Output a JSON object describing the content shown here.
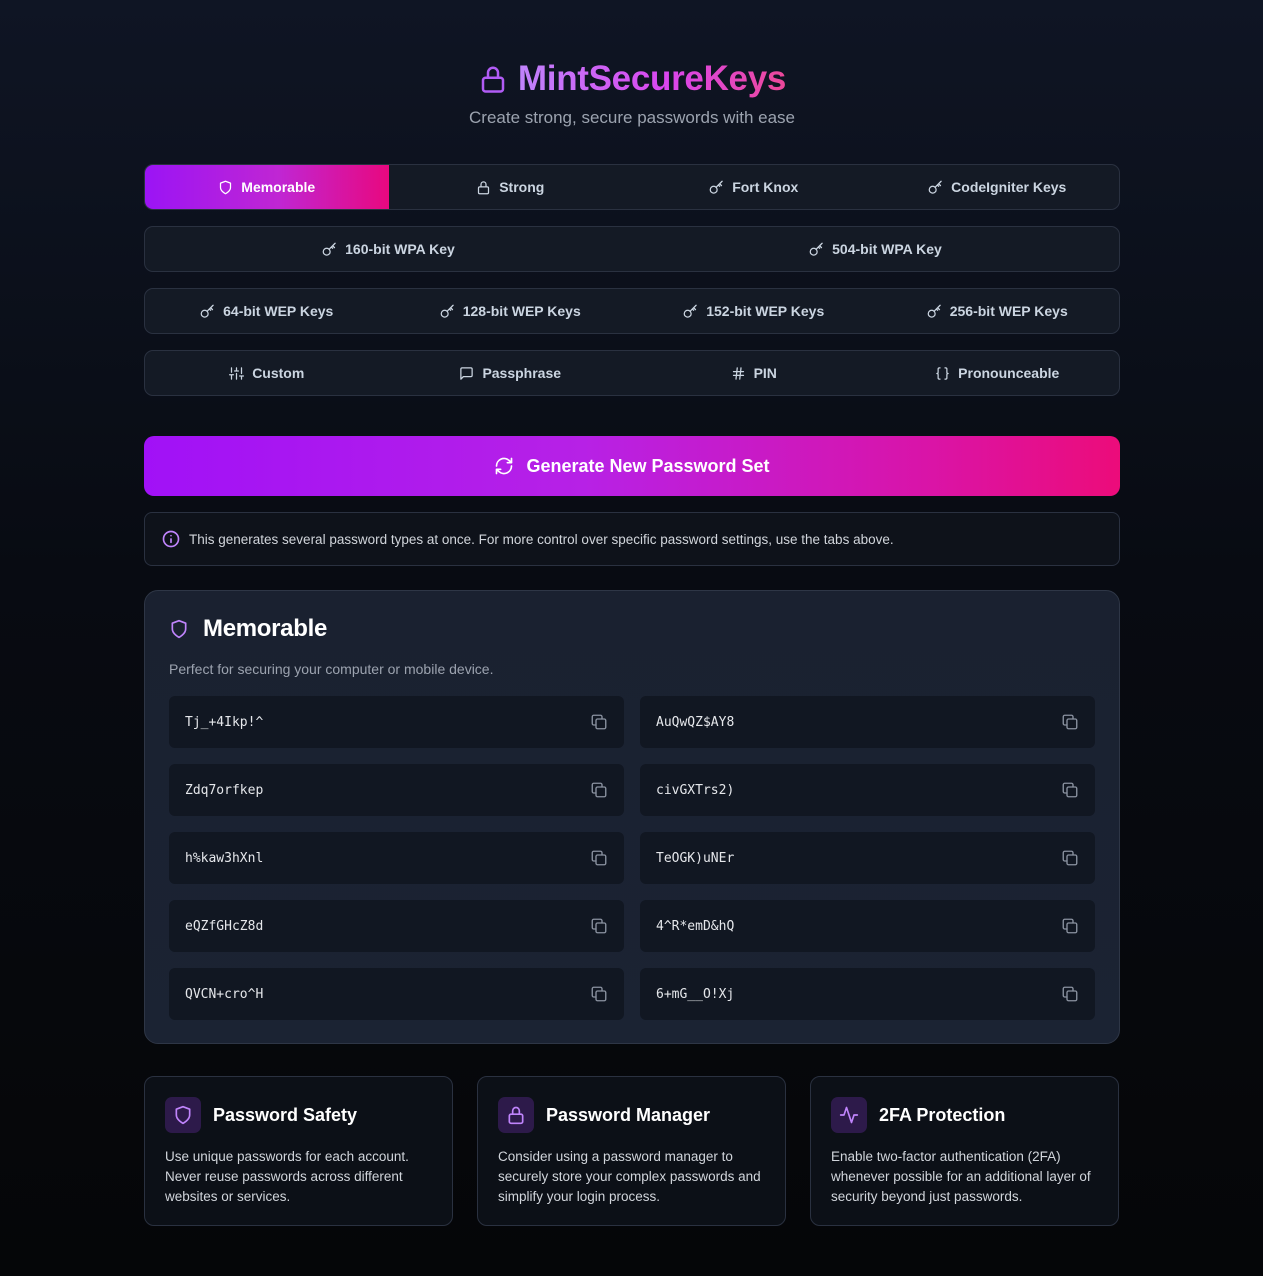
{
  "header": {
    "app_title": "MintSecureKeys",
    "subtitle": "Create strong, secure passwords with ease"
  },
  "tabs": {
    "row1": [
      {
        "label": "Memorable",
        "icon": "shield-icon",
        "active": true
      },
      {
        "label": "Strong",
        "icon": "lock-icon"
      },
      {
        "label": "Fort Knox",
        "icon": "key-icon"
      },
      {
        "label": "CodeIgniter Keys",
        "icon": "key-icon"
      }
    ],
    "row2": [
      {
        "label": "160-bit WPA Key",
        "icon": "key-icon"
      },
      {
        "label": "504-bit WPA Key",
        "icon": "key-icon"
      }
    ],
    "row3": [
      {
        "label": "64-bit WEP Keys",
        "icon": "key-icon"
      },
      {
        "label": "128-bit WEP Keys",
        "icon": "key-icon"
      },
      {
        "label": "152-bit WEP Keys",
        "icon": "key-icon"
      },
      {
        "label": "256-bit WEP Keys",
        "icon": "key-icon"
      }
    ],
    "row4": [
      {
        "label": "Custom",
        "icon": "sliders-icon"
      },
      {
        "label": "Passphrase",
        "icon": "message-icon"
      },
      {
        "label": "PIN",
        "icon": "hash-icon"
      },
      {
        "label": "Pronounceable",
        "icon": "braces-icon"
      }
    ]
  },
  "generate_button": {
    "label": "Generate New Password Set",
    "icon": "refresh-icon"
  },
  "info": {
    "text": "This generates several password types at once. For more control over specific password settings, use the tabs above.",
    "icon": "info-icon"
  },
  "result_card": {
    "title": "Memorable",
    "description": "Perfect for securing your computer or mobile device.",
    "passwords": [
      "Tj_+4Ikp!^",
      "AuQwQZ$AY8",
      "Zdq7orfkep",
      "civGXTrs2)",
      "h%kaw3hXnl",
      "TeOGK)uNEr",
      "eQZfGHcZ8d",
      "4^R*emD&hQ",
      "QVCN+cro^H",
      "6+mG__O!Xj"
    ]
  },
  "tips": [
    {
      "title": "Password Safety",
      "icon": "shield-icon",
      "text": "Use unique passwords for each account. Never reuse passwords across different websites or services."
    },
    {
      "title": "Password Manager",
      "icon": "lock-icon",
      "text": "Consider using a password manager to securely store your complex passwords and simplify your login process."
    },
    {
      "title": "2FA Protection",
      "icon": "activity-icon",
      "text": "Enable two-factor authentication (2FA) whenever possible for an additional layer of security beyond just passwords."
    }
  ],
  "colors": {
    "accent_start": "#9b14f5",
    "accent_end": "#e8087f",
    "icon_purple": "#c084fc"
  }
}
